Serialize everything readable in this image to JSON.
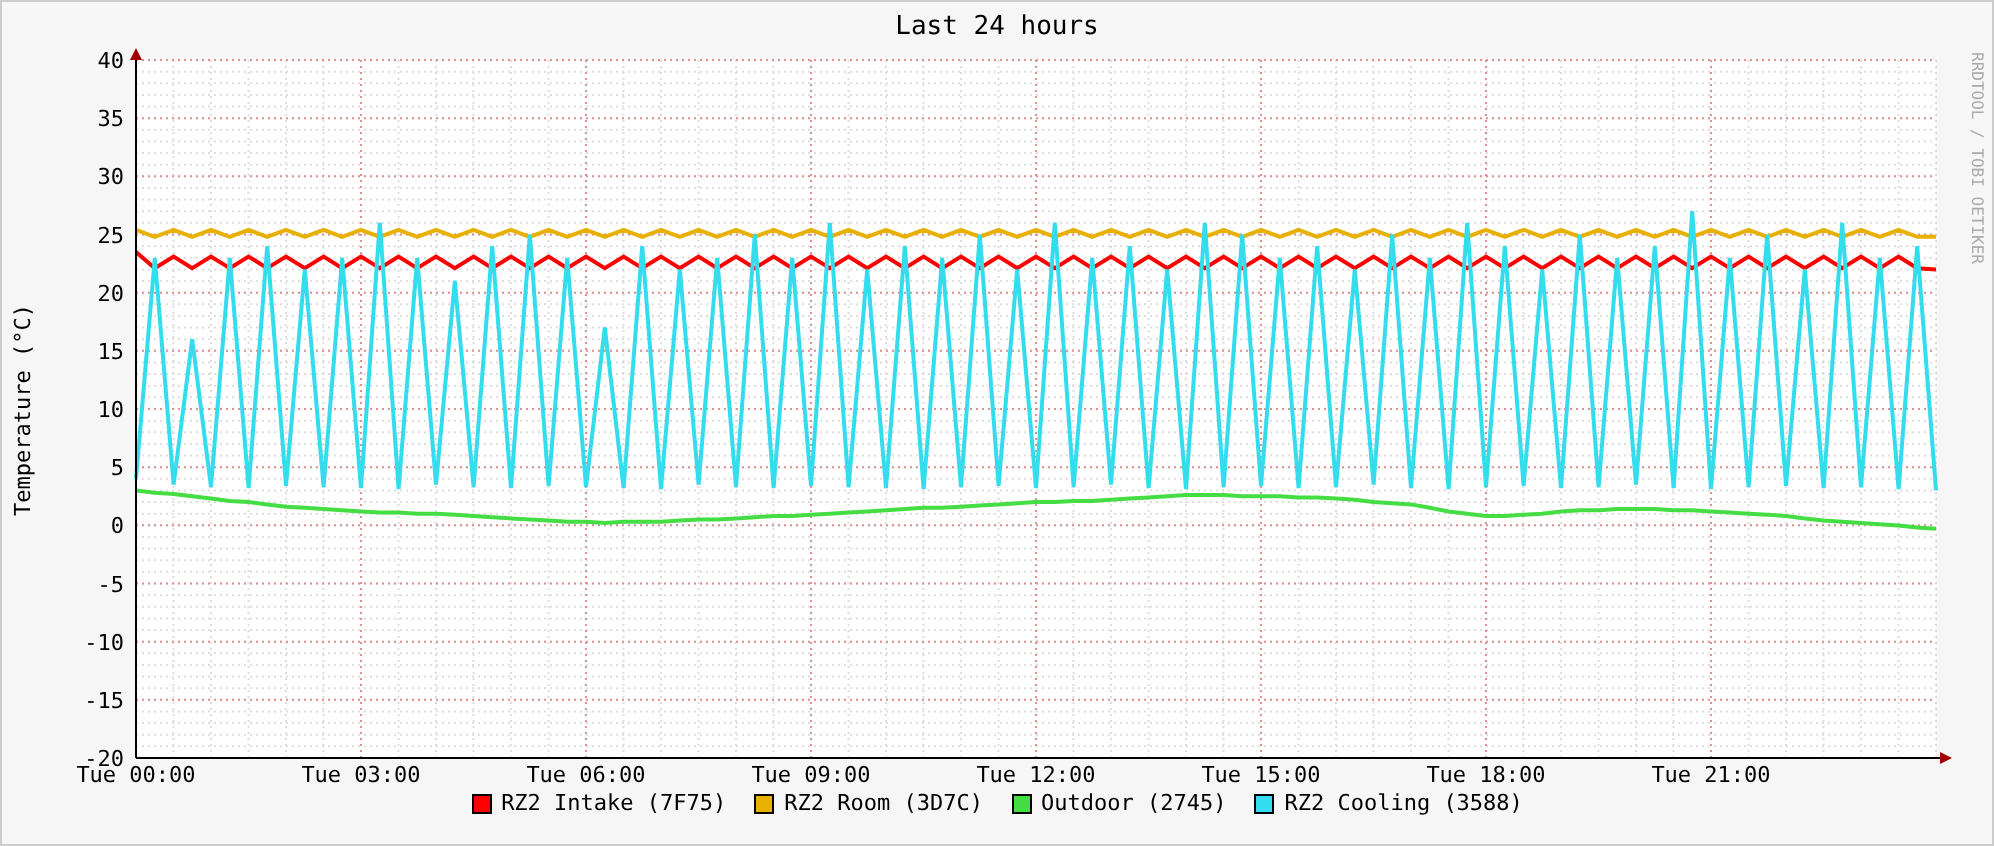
{
  "chart": {
    "credit": "RRDTOOL / TOBI OETIKER",
    "chart_data": {
      "type": "line",
      "title": "Last 24 hours",
      "ylabel": "Temperature (°C)",
      "ylim": [
        -20,
        40
      ],
      "grid": true,
      "yticks": [
        -20,
        -15,
        -10,
        -5,
        0,
        5,
        10,
        15,
        20,
        25,
        30,
        35,
        40
      ],
      "categories": [
        "Tue 00:00",
        null,
        null,
        null,
        null,
        null,
        null,
        null,
        null,
        null,
        null,
        null,
        "Tue 03:00",
        null,
        null,
        null,
        null,
        null,
        null,
        null,
        null,
        null,
        null,
        null,
        "Tue 06:00",
        null,
        null,
        null,
        null,
        null,
        null,
        null,
        null,
        null,
        null,
        null,
        "Tue 09:00",
        null,
        null,
        null,
        null,
        null,
        null,
        null,
        null,
        null,
        null,
        null,
        "Tue 12:00",
        null,
        null,
        null,
        null,
        null,
        null,
        null,
        null,
        null,
        null,
        null,
        "Tue 15:00",
        null,
        null,
        null,
        null,
        null,
        null,
        null,
        null,
        null,
        null,
        null,
        "Tue 18:00",
        null,
        null,
        null,
        null,
        null,
        null,
        null,
        null,
        null,
        null,
        null,
        "Tue 21:00",
        null,
        null,
        null,
        null,
        null,
        null,
        null,
        null,
        null,
        null,
        null,
        null
      ],
      "series": [
        {
          "name": "RZ2 Intake (7F75)",
          "color": "#ff0000",
          "values": [
            23.5,
            22.1,
            23.1,
            22.1,
            23.1,
            22.1,
            23.1,
            22.1,
            23.1,
            22.1,
            23.1,
            22.1,
            23.1,
            22.1,
            23.1,
            22.1,
            23.1,
            22.1,
            23.1,
            22.1,
            23.1,
            22.1,
            23.1,
            22.1,
            23.1,
            22.1,
            23.1,
            22.1,
            23.1,
            22.1,
            23.1,
            22.1,
            23.1,
            22.1,
            23.1,
            22.1,
            23.1,
            22.1,
            23.1,
            22.1,
            23.1,
            22.1,
            23.1,
            22.1,
            23.1,
            22.1,
            23.1,
            22.1,
            23.1,
            22.1,
            23.1,
            22.1,
            23.1,
            22.1,
            23.1,
            22.1,
            23.1,
            22.1,
            23.1,
            22.1,
            23.1,
            22.1,
            23.1,
            22.1,
            23.1,
            22.1,
            23.1,
            22.1,
            23.1,
            22.1,
            23.1,
            22.1,
            23.1,
            22.1,
            23.1,
            22.1,
            23.1,
            22.1,
            23.1,
            22.1,
            23.1,
            22.1,
            23.1,
            22.1,
            23.1,
            22.1,
            23.1,
            22.1,
            23.1,
            22.1,
            23.1,
            22.1,
            23.1,
            22.1,
            23.1,
            22.1,
            22.0
          ]
        },
        {
          "name": "RZ2 Room (3D7C)",
          "color": "#e8b000",
          "values": [
            25.4,
            24.8,
            25.4,
            24.8,
            25.4,
            24.8,
            25.4,
            24.8,
            25.4,
            24.8,
            25.4,
            24.8,
            25.4,
            24.8,
            25.4,
            24.8,
            25.4,
            24.8,
            25.4,
            24.8,
            25.4,
            24.8,
            25.4,
            24.8,
            25.4,
            24.8,
            25.4,
            24.8,
            25.4,
            24.8,
            25.4,
            24.8,
            25.4,
            24.8,
            25.4,
            24.8,
            25.4,
            24.8,
            25.4,
            24.8,
            25.4,
            24.8,
            25.4,
            24.8,
            25.4,
            24.8,
            25.4,
            24.8,
            25.4,
            24.8,
            25.4,
            24.8,
            25.4,
            24.8,
            25.4,
            24.8,
            25.4,
            24.8,
            25.4,
            24.8,
            25.4,
            24.8,
            25.4,
            24.8,
            25.4,
            24.8,
            25.4,
            24.8,
            25.4,
            24.8,
            25.4,
            24.8,
            25.4,
            24.8,
            25.4,
            24.8,
            25.4,
            24.8,
            25.4,
            24.8,
            25.4,
            24.8,
            25.4,
            24.8,
            25.4,
            24.8,
            25.4,
            24.8,
            25.4,
            24.8,
            25.4,
            24.8,
            25.4,
            24.8,
            25.4,
            24.8,
            24.8
          ]
        },
        {
          "name": "Outdoor (2745)",
          "color": "#44dd44",
          "values": [
            3.0,
            2.8,
            2.7,
            2.5,
            2.3,
            2.1,
            2.0,
            1.8,
            1.6,
            1.5,
            1.4,
            1.3,
            1.2,
            1.1,
            1.1,
            1.0,
            1.0,
            0.9,
            0.8,
            0.7,
            0.6,
            0.5,
            0.4,
            0.3,
            0.3,
            0.2,
            0.3,
            0.3,
            0.3,
            0.4,
            0.5,
            0.5,
            0.6,
            0.7,
            0.8,
            0.8,
            0.9,
            1.0,
            1.1,
            1.2,
            1.3,
            1.4,
            1.5,
            1.5,
            1.6,
            1.7,
            1.8,
            1.9,
            2.0,
            2.0,
            2.1,
            2.1,
            2.2,
            2.3,
            2.4,
            2.5,
            2.6,
            2.6,
            2.6,
            2.5,
            2.5,
            2.5,
            2.4,
            2.4,
            2.3,
            2.2,
            2.0,
            1.9,
            1.8,
            1.5,
            1.2,
            1.0,
            0.8,
            0.8,
            0.9,
            1.0,
            1.2,
            1.3,
            1.3,
            1.4,
            1.4,
            1.4,
            1.3,
            1.3,
            1.2,
            1.1,
            1.0,
            0.9,
            0.8,
            0.6,
            0.4,
            0.3,
            0.2,
            0.1,
            0.0,
            -0.2,
            -0.3
          ]
        },
        {
          "name": "RZ2 Cooling (3588)",
          "color": "#33ddee",
          "values": [
            4,
            23,
            3.5,
            16,
            3.3,
            23,
            3.2,
            24,
            3.4,
            22,
            3.3,
            23,
            3.2,
            26,
            3.1,
            23,
            3.5,
            21,
            3.3,
            24,
            3.2,
            25,
            3.4,
            23,
            3.3,
            17,
            3.2,
            24,
            3.1,
            22,
            3.5,
            23,
            3.3,
            25,
            3.2,
            23,
            3.4,
            26,
            3.3,
            22,
            3.2,
            24,
            3.1,
            23,
            3.3,
            25,
            3.4,
            22,
            3.2,
            26,
            3.3,
            23,
            3.5,
            24,
            3.2,
            22,
            3.1,
            26,
            3.3,
            25,
            3.4,
            23,
            3.2,
            24,
            3.3,
            22,
            3.5,
            25,
            3.2,
            23,
            3.1,
            26,
            3.3,
            24,
            3.4,
            22,
            3.2,
            25,
            3.3,
            23,
            3.5,
            24,
            3.2,
            27,
            3.1,
            23,
            3.3,
            25,
            3.4,
            22,
            3.2,
            26,
            3.3,
            23,
            3.1,
            24,
            3.0
          ]
        }
      ]
    }
  }
}
